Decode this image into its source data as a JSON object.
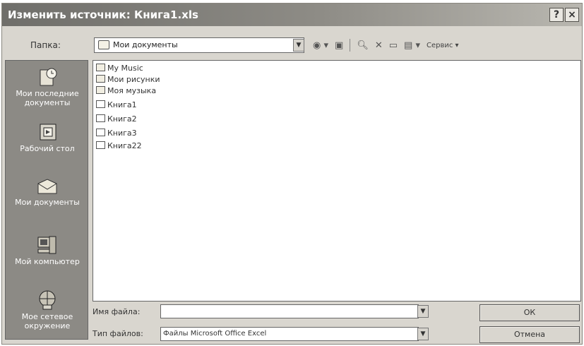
{
  "title": "Изменить источник: Книга1.xls",
  "title_buttons": {
    "help": "?",
    "close": "×"
  },
  "lookin": {
    "label": "Папка:",
    "value": "Мои документы"
  },
  "toolbar": {
    "service_label": "Сервис"
  },
  "places": [
    {
      "label": "Мои последние документы",
      "icon": "recent-documents-icon"
    },
    {
      "label": "Рабочий стол",
      "icon": "desktop-icon"
    },
    {
      "label": "Мои документы",
      "icon": "my-documents-icon"
    },
    {
      "label": "Мой компьютер",
      "icon": "my-computer-icon"
    },
    {
      "label": "Мое сетевое окружение",
      "icon": "network-places-icon"
    }
  ],
  "files": [
    {
      "name": "My Music",
      "type": "folder"
    },
    {
      "name": "Мои рисунки",
      "type": "folder"
    },
    {
      "name": "Моя музыка",
      "type": "folder"
    },
    {
      "name": "Книга1",
      "type": "xls"
    },
    {
      "name": "Книга2",
      "type": "xls"
    },
    {
      "name": "Книга3",
      "type": "xls"
    },
    {
      "name": "Книга22",
      "type": "xls"
    }
  ],
  "filename": {
    "label": "Имя файла:",
    "value": ""
  },
  "filetype": {
    "label": "Тип файлов:",
    "value": "Файлы Microsoft Office Excel"
  },
  "buttons": {
    "ok": "ОК",
    "cancel": "Отмена"
  }
}
